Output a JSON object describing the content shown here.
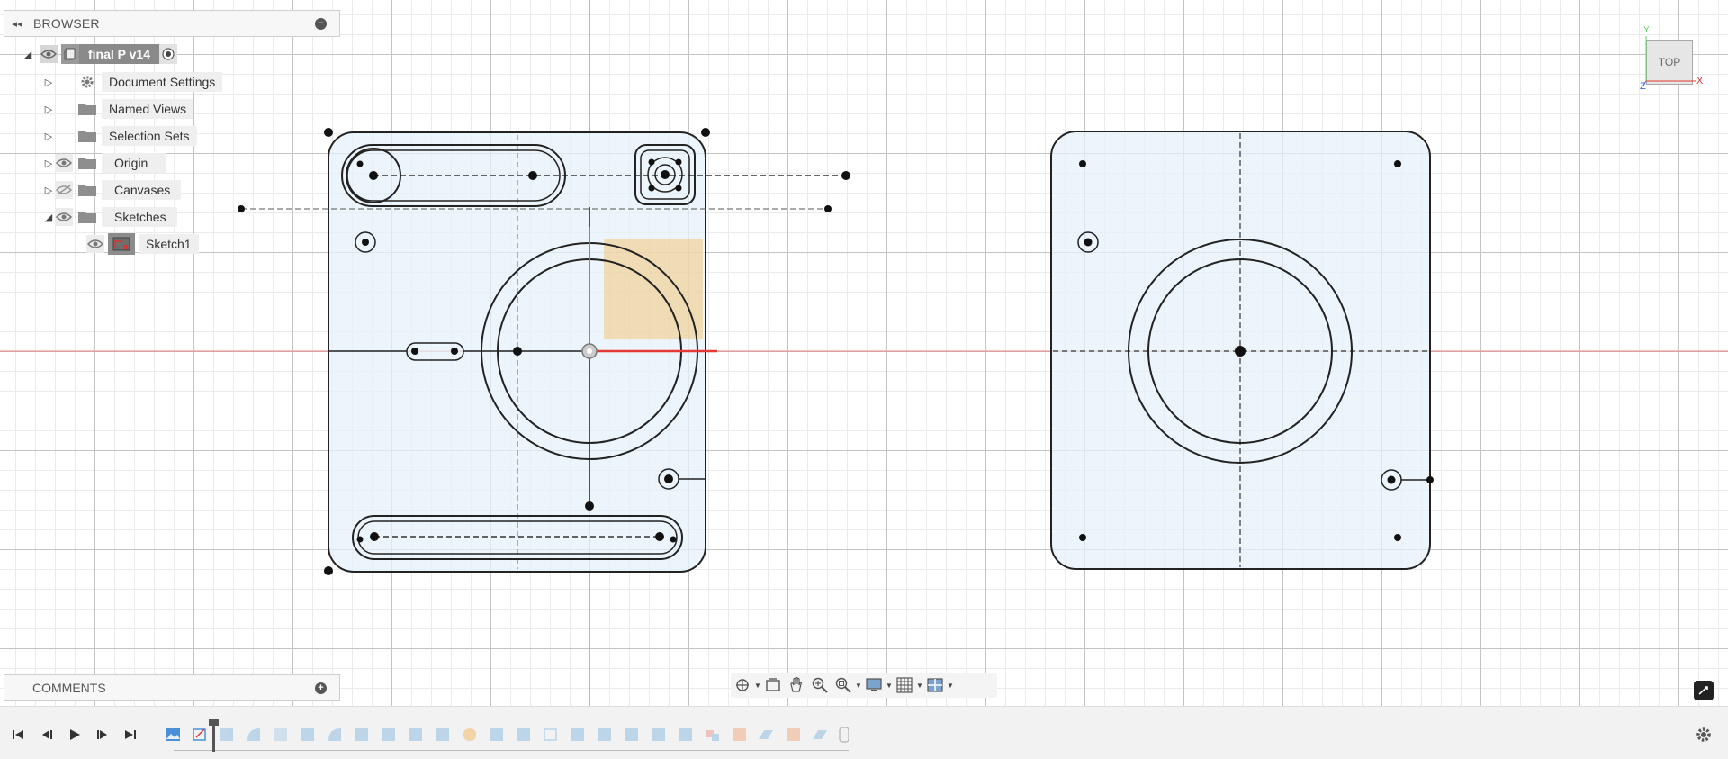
{
  "browser": {
    "title": "BROWSER",
    "root": {
      "label": "final P v14"
    },
    "items": [
      {
        "label": "Document Settings",
        "icon": "gear-icon",
        "eye": "none"
      },
      {
        "label": "Named Views",
        "icon": "folder-icon",
        "eye": "none"
      },
      {
        "label": "Selection Sets",
        "icon": "folder-icon",
        "eye": "none"
      },
      {
        "label": "Origin",
        "icon": "folder-icon",
        "eye": "visible"
      },
      {
        "label": "Canvases",
        "icon": "folder-icon",
        "eye": "hidden"
      },
      {
        "label": "Sketches",
        "icon": "folder-icon",
        "eye": "visible",
        "expanded": true
      }
    ],
    "sketch_child": {
      "label": "Sketch1",
      "icon": "sketch-icon"
    }
  },
  "viewcube": {
    "face": "TOP",
    "axes": {
      "x": "X",
      "y": "Y",
      "z": "Z"
    }
  },
  "comments": {
    "title": "COMMENTS"
  },
  "navbar": {
    "tools": [
      "orbit-icon",
      "look-at-icon",
      "pan-icon",
      "zoom-icon",
      "fit-icon",
      "display-settings-icon",
      "grid-icon",
      "viewports-icon"
    ]
  },
  "timeline": {
    "controls": [
      "skip-to-start-icon",
      "step-back-icon",
      "play-icon",
      "step-forward-icon",
      "skip-to-end-icon"
    ],
    "feature_count": 26
  },
  "colors": {
    "accent_x": "#e53935",
    "accent_y": "#43c843",
    "sketch_fill": "#dcecf7",
    "selection_fill": "#f2c47a"
  }
}
